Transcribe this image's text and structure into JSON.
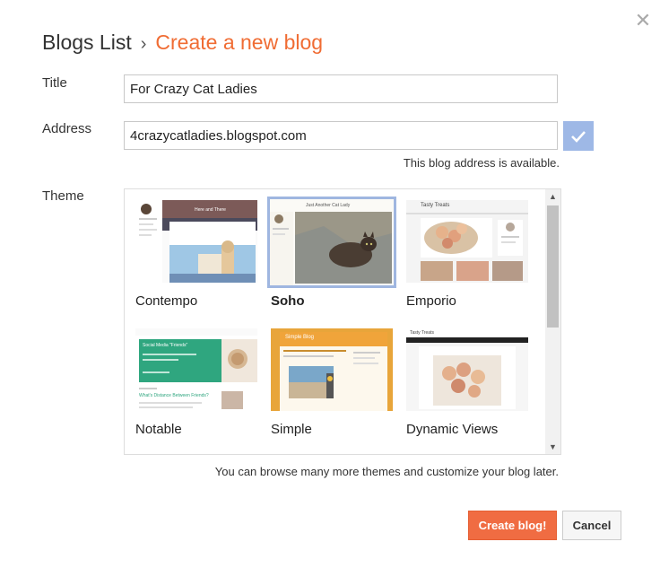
{
  "header": {
    "crumb": "Blogs List",
    "separator": "›",
    "current": "Create a new blog"
  },
  "form": {
    "title_label": "Title",
    "title_value": "For Crazy Cat Ladies",
    "address_label": "Address",
    "address_value": "4crazycatladies.blogspot.com",
    "address_status": "This blog address is available.",
    "theme_label": "Theme"
  },
  "themes": [
    {
      "name": "Contempo",
      "thumb_caption": "Here and There"
    },
    {
      "name": "Soho",
      "selected": true,
      "thumb_caption": "Just Another Cat Lady"
    },
    {
      "name": "Emporio",
      "thumb_caption": "Tasty Treats"
    },
    {
      "name": "Notable",
      "thumb_caption": "Social Media \"Friends\"",
      "thumb_subcaption": "What's Distance Between Friends?"
    },
    {
      "name": "Simple",
      "thumb_caption": "Simple Blog"
    },
    {
      "name": "Dynamic Views",
      "thumb_caption": "Tasty Treats"
    }
  ],
  "note": "You can browse many more themes and customize your blog later.",
  "buttons": {
    "create": "Create blog!",
    "cancel": "Cancel"
  },
  "icons": {
    "close": "close-icon",
    "check": "check-icon"
  },
  "colors": {
    "accent": "#f06c33",
    "check_bg": "#9eb8e6",
    "selected_border": "#9fb6e0"
  }
}
